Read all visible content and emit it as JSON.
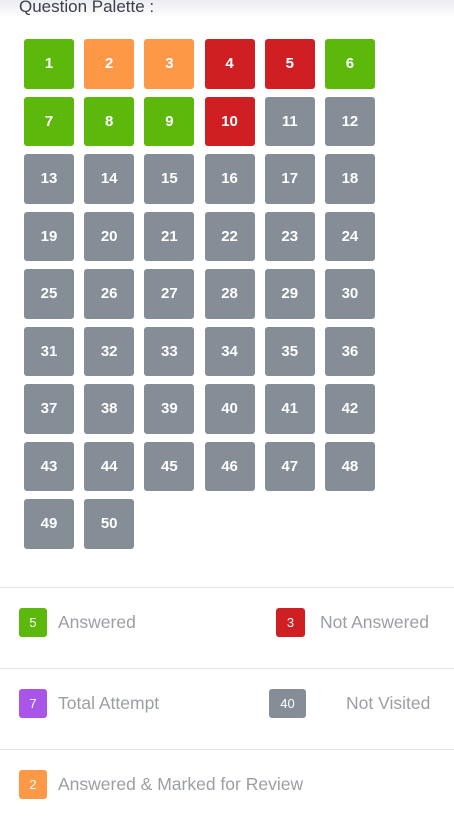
{
  "palette": {
    "title": "Question Palette :",
    "questions": [
      {
        "n": "1",
        "status": "answered"
      },
      {
        "n": "2",
        "status": "marked"
      },
      {
        "n": "3",
        "status": "marked"
      },
      {
        "n": "4",
        "status": "not-answered"
      },
      {
        "n": "5",
        "status": "not-answered"
      },
      {
        "n": "6",
        "status": "answered"
      },
      {
        "n": "7",
        "status": "answered"
      },
      {
        "n": "8",
        "status": "answered"
      },
      {
        "n": "9",
        "status": "answered"
      },
      {
        "n": "10",
        "status": "not-answered"
      },
      {
        "n": "11",
        "status": "not-visited"
      },
      {
        "n": "12",
        "status": "not-visited"
      },
      {
        "n": "13",
        "status": "not-visited"
      },
      {
        "n": "14",
        "status": "not-visited"
      },
      {
        "n": "15",
        "status": "not-visited"
      },
      {
        "n": "16",
        "status": "not-visited"
      },
      {
        "n": "17",
        "status": "not-visited"
      },
      {
        "n": "18",
        "status": "not-visited"
      },
      {
        "n": "19",
        "status": "not-visited"
      },
      {
        "n": "20",
        "status": "not-visited"
      },
      {
        "n": "21",
        "status": "not-visited"
      },
      {
        "n": "22",
        "status": "not-visited"
      },
      {
        "n": "23",
        "status": "not-visited"
      },
      {
        "n": "24",
        "status": "not-visited"
      },
      {
        "n": "25",
        "status": "not-visited"
      },
      {
        "n": "26",
        "status": "not-visited"
      },
      {
        "n": "27",
        "status": "not-visited"
      },
      {
        "n": "28",
        "status": "not-visited"
      },
      {
        "n": "29",
        "status": "not-visited"
      },
      {
        "n": "30",
        "status": "not-visited"
      },
      {
        "n": "31",
        "status": "not-visited"
      },
      {
        "n": "32",
        "status": "not-visited"
      },
      {
        "n": "33",
        "status": "not-visited"
      },
      {
        "n": "34",
        "status": "not-visited"
      },
      {
        "n": "35",
        "status": "not-visited"
      },
      {
        "n": "36",
        "status": "not-visited"
      },
      {
        "n": "37",
        "status": "not-visited"
      },
      {
        "n": "38",
        "status": "not-visited"
      },
      {
        "n": "39",
        "status": "not-visited"
      },
      {
        "n": "40",
        "status": "not-visited"
      },
      {
        "n": "41",
        "status": "not-visited"
      },
      {
        "n": "42",
        "status": "not-visited"
      },
      {
        "n": "43",
        "status": "not-visited"
      },
      {
        "n": "44",
        "status": "not-visited"
      },
      {
        "n": "45",
        "status": "not-visited"
      },
      {
        "n": "46",
        "status": "not-visited"
      },
      {
        "n": "47",
        "status": "not-visited"
      },
      {
        "n": "48",
        "status": "not-visited"
      },
      {
        "n": "49",
        "status": "not-visited"
      },
      {
        "n": "50",
        "status": "not-visited"
      }
    ]
  },
  "legend": {
    "answered": {
      "count": "5",
      "label": "Answered"
    },
    "not_answered": {
      "count": "3",
      "label": "Not Answered"
    },
    "total_attempt": {
      "count": "7",
      "label": "Total Attempt"
    },
    "not_visited": {
      "count": "40",
      "label": "Not Visited"
    },
    "marked_review": {
      "count": "2",
      "label": "Answered & Marked for Review"
    }
  },
  "colors": {
    "answered": "#5cb80a",
    "marked": "#fd9847",
    "not_answered": "#cf1f23",
    "not_visited": "#858d96",
    "total_attempt": "#a855e8"
  }
}
